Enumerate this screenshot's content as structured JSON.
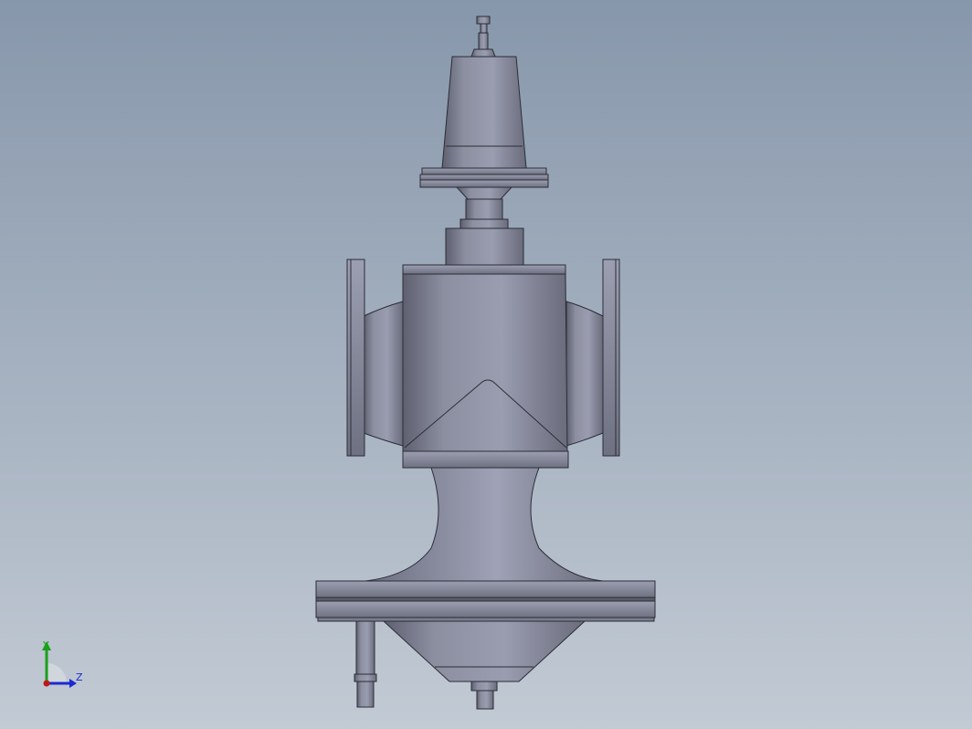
{
  "viewport": {
    "background_top": "#8797ab",
    "background_bottom": "#c2cad4",
    "model": {
      "name": "valve-assembly",
      "body_color": "#8a8d9d",
      "edge_color": "#2b2d36"
    }
  },
  "triad": {
    "y_label": "Y",
    "z_label": "Z",
    "y_color": "#1aa01a",
    "z_color": "#1a2ad0",
    "origin_color": "#c01818"
  }
}
